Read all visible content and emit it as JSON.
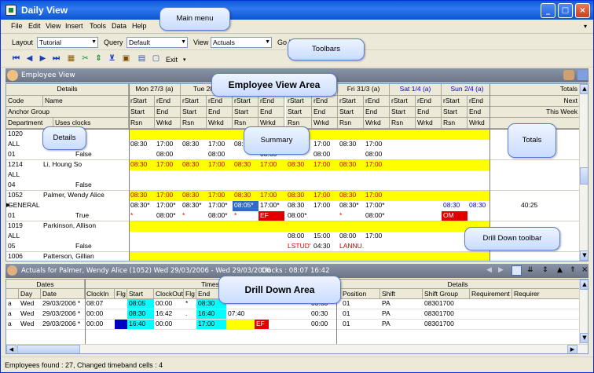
{
  "window": {
    "title": "Daily View"
  },
  "menu": [
    "File",
    "Edit",
    "View",
    "Insert",
    "Tools",
    "Data",
    "Help"
  ],
  "toolbar1": {
    "layout_label": "Layout",
    "layout_value": "Tutorial",
    "query_label": "Query",
    "query_value": "Default",
    "view_label": "View",
    "view_value": "Actuals",
    "go_label": "Go !"
  },
  "toolbar2": {
    "exit_label": "Exit"
  },
  "employee_view": {
    "title": "Employee View",
    "details_header": "Details",
    "col_code": "Code",
    "col_name": "Name",
    "anchor_group": "Anchor Group",
    "department": "Department",
    "uses_clocks": "Uses clocks",
    "days": [
      {
        "label": "Mon 27/3 (a)",
        "weekend": false
      },
      {
        "label": "Tue 28/3",
        "weekend": false
      },
      {
        "label": "",
        "weekend": false
      },
      {
        "label": "",
        "weekend": false
      },
      {
        "label": "Fri 31/3 (a)",
        "weekend": false
      },
      {
        "label": "Sat 1/4 (a)",
        "weekend": true
      },
      {
        "label": "Sun 2/4 (a)",
        "weekend": true
      }
    ],
    "sub1": [
      "rStart",
      "rEnd"
    ],
    "sub2": [
      "Start",
      "End"
    ],
    "sub3": [
      "Rsn",
      "Wrkd"
    ],
    "totals": {
      "header": "Totals",
      "line1": "Next",
      "line2": "This Week",
      "value": "40:25"
    },
    "employees": [
      {
        "code": "1020",
        "name": "",
        "anchor": "ALL",
        "dept": "01",
        "clocks": "False"
      },
      {
        "code": "1214",
        "name": "Li, Houng So",
        "anchor": "ALL",
        "dept": "04",
        "clocks": "False"
      },
      {
        "code": "1052",
        "name": "Palmer, Wendy Alice",
        "anchor": "GENERAL",
        "dept": "01",
        "clocks": "True"
      },
      {
        "code": "1019",
        "name": "Parkinson, Allison",
        "anchor": "ALL",
        "dept": "05",
        "clocks": "False"
      },
      {
        "code": "1006",
        "name": "Patterson, Gillian",
        "anchor": "",
        "dept": "",
        "clocks": ""
      }
    ],
    "cells": {
      "t0830": "08:30",
      "t1700": "17:00",
      "t0800": "08:00",
      "t0830s": "08:30*",
      "t1700s": "17:00*",
      "t0800s": "08:00*",
      "t0805s": "08:05*",
      "ef": "EF",
      "om": "OM",
      "star": "*",
      "t1500": "15:00",
      "t0430": "04:30",
      "lstud": "LSTUD'",
      "lannu": "LANNU."
    }
  },
  "drill": {
    "title": "Actuals for Palmer, Wendy Alice (1052) Wed 29/03/2006 - Wed 29/03/2006",
    "clocks": "Clocks : 08:07 16:42",
    "group_dates": "Dates",
    "group_times": "Times",
    "group_details": "Details",
    "columns": [
      "Day",
      "Date",
      "ClockIn",
      "Flg",
      "Start",
      "ClockOut",
      "Flg",
      "End",
      "",
      "Department",
      "Position",
      "Shift",
      "Shift Group",
      "Requirement",
      "Requirer"
    ],
    "rows": [
      [
        "a",
        "Wed",
        "29/03/2006 *",
        "08:07",
        "",
        "08:05",
        "00:00",
        "*",
        "08:30",
        "",
        "",
        "00:30",
        "01",
        "PA",
        "08301700"
      ],
      [
        "a",
        "Wed",
        "29/03/2006 *",
        "00:00",
        "",
        "08:30",
        "16:42",
        ".",
        "16:40",
        "07:40",
        "",
        "00:30",
        "01",
        "PA",
        "08301700"
      ],
      [
        "a",
        "Wed",
        "29/03/2006 *",
        "00:00",
        "",
        "16:40",
        "00:00",
        "",
        "17:00",
        "",
        "EF",
        "00:00",
        "01",
        "PA",
        "08301700"
      ]
    ]
  },
  "status": "Employees found : 27, Changed timeband cells : 4",
  "callouts": {
    "main_menu": "Main menu",
    "toolbars": "Toolbars",
    "employee_view_area": "Employee View Area",
    "details": "Details",
    "summary": "Summary",
    "totals": "Totals",
    "drill_toolbar": "Drill Down toolbar",
    "drill_area": "Drill Down Area"
  }
}
